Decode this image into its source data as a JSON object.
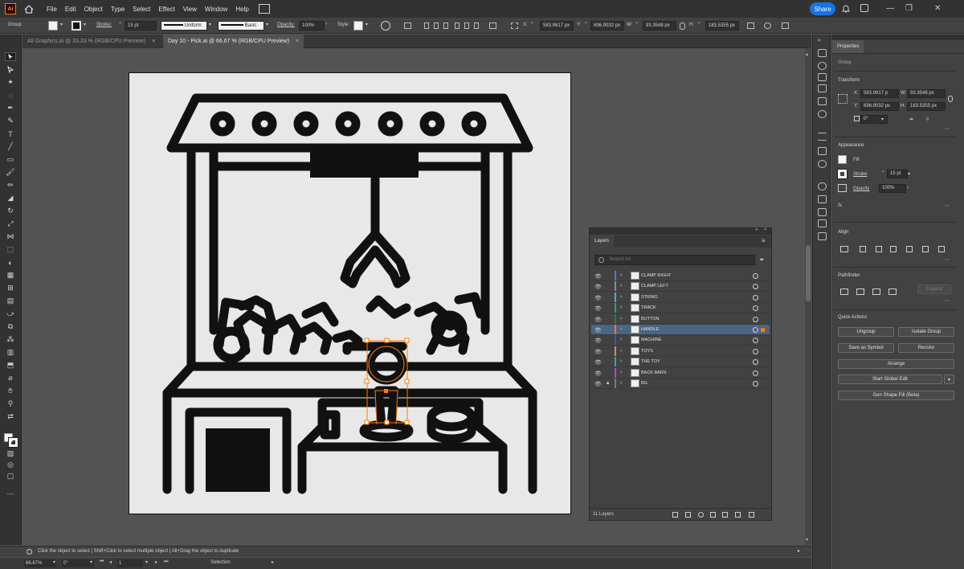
{
  "menubar": {
    "app_logo": "Ai",
    "items": [
      "File",
      "Edit",
      "Object",
      "Type",
      "Select",
      "Effect",
      "View",
      "Window",
      "Help"
    ],
    "share_label": "Share",
    "window_controls": [
      "—",
      "❐",
      "✕"
    ]
  },
  "controlbar": {
    "selection_type": "Group",
    "stroke_label": "Stroke:",
    "stroke_weight": "15 pt",
    "profile": "Uniform",
    "brush": "Basic",
    "opacity_label": "Opacity:",
    "opacity_value": "100%",
    "style_label": "Style:",
    "x_label": "X:",
    "x_value": "583.9817 px",
    "y_label": "Y:",
    "y_value": "696.9032 px",
    "w_label": "W:",
    "w_value": "93.3548 px",
    "h_label": "H:",
    "h_value": "183.5355 px"
  },
  "tabs": [
    {
      "label": "All Graphics.ai @ 33.33 % (RGB/CPU Preview)",
      "active": false
    },
    {
      "label": "Day 10 - Pick.ai @ 66.67 % (RGB/CPU Preview)",
      "active": true
    }
  ],
  "tab_close": "×",
  "status": {
    "hint": "Click the object to select  |  Shift+Click to select multiple object  |  Alt+Drag the object to duplicate",
    "zoom": "66.67%",
    "rotation": "0°",
    "artboard_num": "1",
    "tool_name": "Selection"
  },
  "properties": {
    "tab": "Properties",
    "object_type": "Group",
    "transform_title": "Transform",
    "x_label": "X:",
    "x_value": "583.9817 p",
    "y_label": "Y:",
    "y_value": "696.9032 px",
    "w_label": "W:",
    "w_value": "93.3548 px",
    "h_label": "H:",
    "h_value": "183.5355 px",
    "rotate_value": "0°",
    "appearance_title": "Appearance",
    "fill_label": "Fill",
    "stroke_label": "Stroke",
    "stroke_value": "15 pt",
    "opacity_label": "Opacity",
    "opacity_value": "100%",
    "fx_label": "fx.",
    "align_title": "Align",
    "pathfinder_title": "Pathfinder",
    "expand_label": "Expand",
    "quick_actions_title": "Quick Actions",
    "buttons": {
      "ungroup": "Ungroup",
      "isolate_group": "Isolate Group",
      "save_as_symbol": "Save as Symbol",
      "recolor": "Recolor",
      "arrange": "Arrange",
      "start_global_edit": "Start Global Edit",
      "gen_shape_fill": "Gen Shape Fill (Beta)"
    }
  },
  "layers": {
    "tab": "Layers",
    "search_placeholder": "Search All",
    "footer_count": "11 Layers",
    "rows": [
      {
        "name": "CLAMP RIGHT",
        "color": "#4f7dd6",
        "selected": false,
        "locked": false
      },
      {
        "name": "CLAMP LEFT",
        "color": "#8a8a8a",
        "selected": false,
        "locked": false
      },
      {
        "name": "STRING",
        "color": "#3fb6c6",
        "selected": false,
        "locked": false
      },
      {
        "name": "TRACK",
        "color": "#28a08c",
        "selected": false,
        "locked": false
      },
      {
        "name": "BUTTON",
        "color": "#2f7a3a",
        "selected": false,
        "locked": false
      },
      {
        "name": "HANDLE",
        "color": "#ff7c00",
        "selected": true,
        "locked": false
      },
      {
        "name": "MACHINE",
        "color": "#4b4fc9",
        "selected": false,
        "locked": false
      },
      {
        "name": "TOYS",
        "color": "#d28a58",
        "selected": false,
        "locked": false
      },
      {
        "name": "THE TOY",
        "color": "#3aa6a0",
        "selected": false,
        "locked": false
      },
      {
        "name": "BACK BARS",
        "color": "#c83fb5",
        "selected": false,
        "locked": false
      },
      {
        "name": "BG",
        "color": "#7a7a7a",
        "selected": false,
        "locked": true
      }
    ]
  },
  "colors": {
    "accent": "#1473e6",
    "selection": "#ff7c00",
    "artboard_bg": "#e8e8e8",
    "art_stroke": "#111111"
  }
}
